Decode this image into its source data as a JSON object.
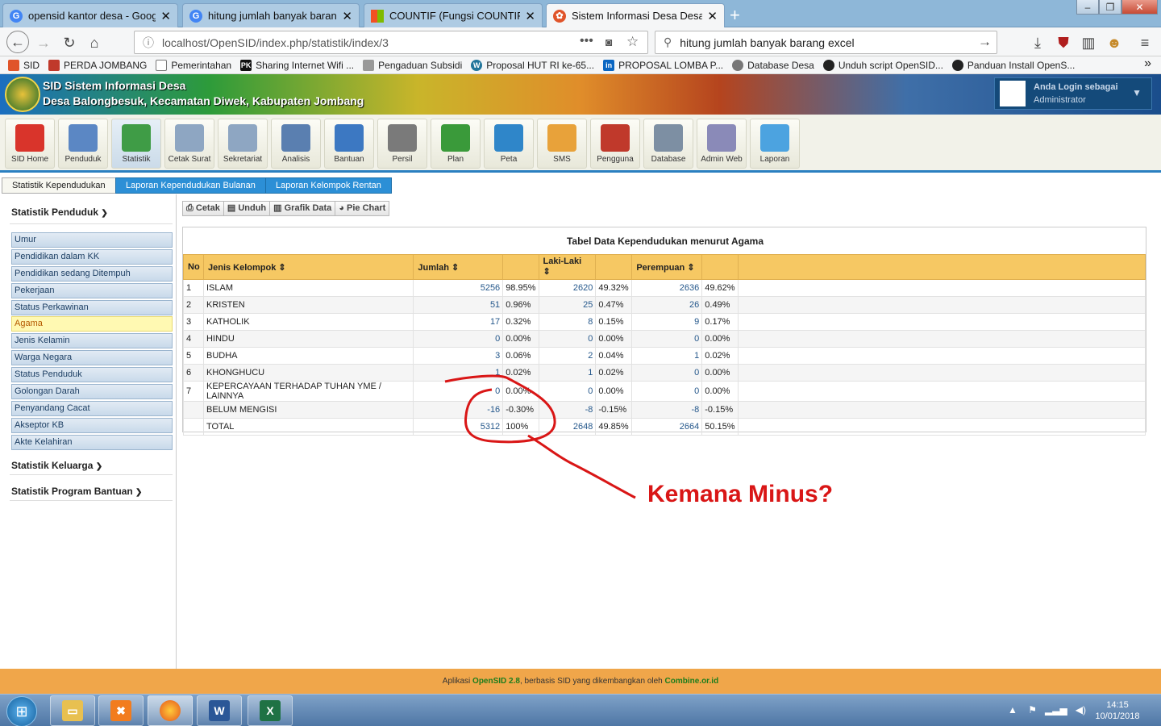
{
  "browser": {
    "tabs": [
      {
        "label": "opensid kantor desa - Google S",
        "icon": "google-icon",
        "color": "#4285f4"
      },
      {
        "label": "hitung jumlah banyak barang e",
        "icon": "google-icon",
        "color": "#4285f4"
      },
      {
        "label": "COUNTIF (Fungsi COUNTIF) - D",
        "icon": "microsoft-icon",
        "color": "#f25022"
      },
      {
        "label": "Sistem Informasi Desa Desa Bal",
        "icon": "opensid-icon",
        "color": "#e0542a"
      }
    ],
    "url": "localhost/OpenSID/index.php/statistik/index/3",
    "search": "hitung jumlah banyak barang excel",
    "bookmarks": [
      "SID",
      "PERDA JOMBANG",
      "Pemerintahan",
      "Sharing Internet Wifi ...",
      "Pengaduan Subsidi",
      "Proposal HUT RI ke-65...",
      "PROPOSAL LOMBA P...",
      "Database Desa",
      "Unduh script OpenSID...",
      "Panduan Install OpenS..."
    ]
  },
  "site": {
    "title": "SID Sistem Informasi Desa",
    "subtitle": "Desa Balongbesuk, Kecamatan Diwek, Kabupaten Jombang",
    "login_line1": "Anda Login sebagai",
    "login_line2": "Administrator"
  },
  "toolbar": [
    {
      "label": "SID Home",
      "color": "#d9342b"
    },
    {
      "label": "Penduduk",
      "color": "#5b87c4"
    },
    {
      "label": "Statistik",
      "color": "#3f9c46"
    },
    {
      "label": "Cetak Surat",
      "color": "#8ea6c2"
    },
    {
      "label": "Sekretariat",
      "color": "#8ea6c2"
    },
    {
      "label": "Analisis",
      "color": "#5a7fb0"
    },
    {
      "label": "Bantuan",
      "color": "#3c78c2"
    },
    {
      "label": "Persil",
      "color": "#7a7a7a"
    },
    {
      "label": "Plan",
      "color": "#3a9a3a"
    },
    {
      "label": "Peta",
      "color": "#2f86c9"
    },
    {
      "label": "SMS",
      "color": "#e8a23a"
    },
    {
      "label": "Pengguna",
      "color": "#c0392b"
    },
    {
      "label": "Database",
      "color": "#7d8fa3"
    },
    {
      "label": "Admin Web",
      "color": "#8a8ab8"
    },
    {
      "label": "Laporan",
      "color": "#4ca3e0"
    }
  ],
  "subtabs": [
    "Statistik Kependudukan",
    "Laporan Kependudukan Bulanan",
    "Laporan Kelompok Rentan"
  ],
  "sidebar": {
    "section1": "Statistik Penduduk",
    "items": [
      "Umur",
      "Pendidikan dalam KK",
      "Pendidikan sedang Ditempuh",
      "Pekerjaan",
      "Status Perkawinan",
      "Agama",
      "Jenis Kelamin",
      "Warga Negara",
      "Status Penduduk",
      "Golongan Darah",
      "Penyandang Cacat",
      "Akseptor KB",
      "Akte Kelahiran"
    ],
    "section2": "Statistik Keluarga",
    "section3": "Statistik Program Bantuan"
  },
  "buttons": [
    "Cetak",
    "Unduh",
    "Grafik Data",
    "Pie Chart"
  ],
  "table": {
    "title": "Tabel Data Kependudukan menurut Agama",
    "headers": {
      "no": "No",
      "jenis": "Jenis Kelompok",
      "jumlah": "Jumlah",
      "laki": "Laki-Laki",
      "perempuan": "Perempuan"
    },
    "rows": [
      {
        "no": "1",
        "name": "ISLAM",
        "jumlah": "5256",
        "jp": "98.95%",
        "laki": "2620",
        "lp": "49.32%",
        "perempuan": "2636",
        "pp": "49.62%"
      },
      {
        "no": "2",
        "name": "KRISTEN",
        "jumlah": "51",
        "jp": "0.96%",
        "laki": "25",
        "lp": "0.47%",
        "perempuan": "26",
        "pp": "0.49%"
      },
      {
        "no": "3",
        "name": "KATHOLIK",
        "jumlah": "17",
        "jp": "0.32%",
        "laki": "8",
        "lp": "0.15%",
        "perempuan": "9",
        "pp": "0.17%"
      },
      {
        "no": "4",
        "name": "HINDU",
        "jumlah": "0",
        "jp": "0.00%",
        "laki": "0",
        "lp": "0.00%",
        "perempuan": "0",
        "pp": "0.00%"
      },
      {
        "no": "5",
        "name": "BUDHA",
        "jumlah": "3",
        "jp": "0.06%",
        "laki": "2",
        "lp": "0.04%",
        "perempuan": "1",
        "pp": "0.02%"
      },
      {
        "no": "6",
        "name": "KHONGHUCU",
        "jumlah": "1",
        "jp": "0.02%",
        "laki": "1",
        "lp": "0.02%",
        "perempuan": "0",
        "pp": "0.00%"
      },
      {
        "no": "7",
        "name": "KEPERCAYAAN TERHADAP TUHAN YME / LAINNYA",
        "jumlah": "0",
        "jp": "0.00%",
        "laki": "0",
        "lp": "0.00%",
        "perempuan": "0",
        "pp": "0.00%"
      },
      {
        "no": "",
        "name": "BELUM MENGISI",
        "jumlah": "-16",
        "jp": "-0.30%",
        "laki": "-8",
        "lp": "-0.15%",
        "perempuan": "-8",
        "pp": "-0.15%"
      },
      {
        "no": "",
        "name": "TOTAL",
        "jumlah": "5312",
        "jp": "100%",
        "laki": "2648",
        "lp": "49.85%",
        "perempuan": "2664",
        "pp": "50.15%"
      }
    ]
  },
  "annotation": "Kemana Minus?",
  "footer": {
    "pre": "Aplikasi",
    "app": "OpenSID 2.8",
    "mid": ", berbasis SID yang dikembangkan oleh",
    "org": "Combine.or.id"
  },
  "taskbar": {
    "time": "14:15",
    "date": "10/01/2018"
  }
}
